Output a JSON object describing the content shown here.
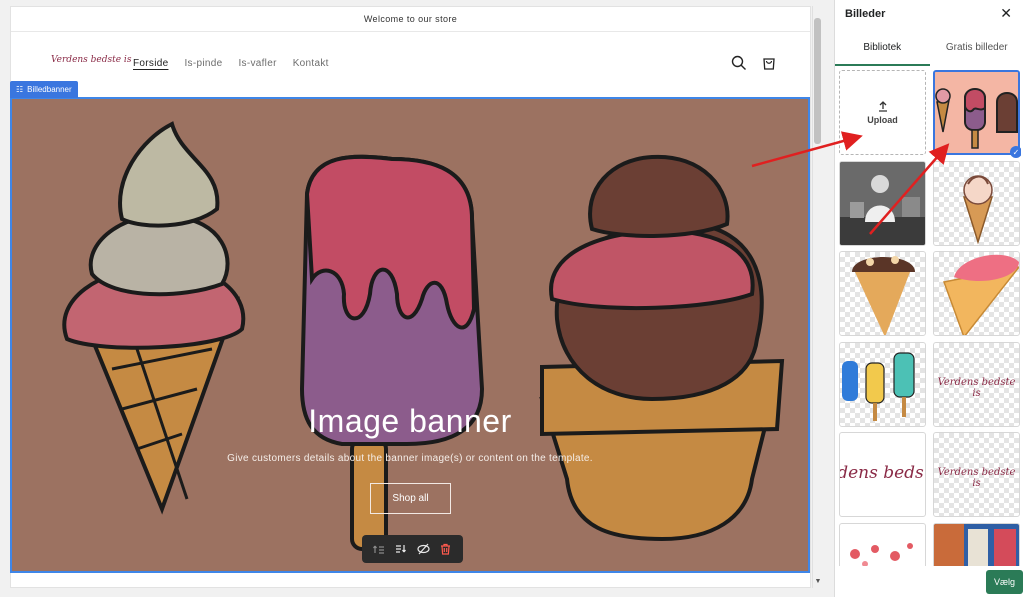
{
  "store": {
    "announcement": "Welcome to our store",
    "logo_text": "Verdens bedste is",
    "nav": [
      {
        "label": "Forside",
        "active": true
      },
      {
        "label": "Is-pinde",
        "active": false
      },
      {
        "label": "Is-vafler",
        "active": false
      },
      {
        "label": "Kontakt",
        "active": false
      }
    ],
    "header_icons": [
      "search-icon",
      "cart-icon"
    ]
  },
  "section_tag": {
    "label": "Billedbanner",
    "icon": "grid-icon"
  },
  "banner": {
    "title": "Image banner",
    "subtitle": "Give customers details about the banner image(s) or content on the template.",
    "button_label": "Shop all",
    "background_color": "#9c7261",
    "toolbar_icons": [
      "move-up-icon",
      "move-down-icon",
      "hide-icon",
      "delete-icon"
    ]
  },
  "panel": {
    "title": "Billeder",
    "tabs": [
      {
        "label": "Bibliotek",
        "active": true
      },
      {
        "label": "Gratis billeder",
        "active": false
      }
    ],
    "upload_label": "Upload",
    "thumb_text": "Verdens bedste is",
    "thumb_text_partial": "dens beds",
    "select_button": "Vælg",
    "accent_color": "#2b7b57",
    "annotation_color": "#e02020"
  }
}
